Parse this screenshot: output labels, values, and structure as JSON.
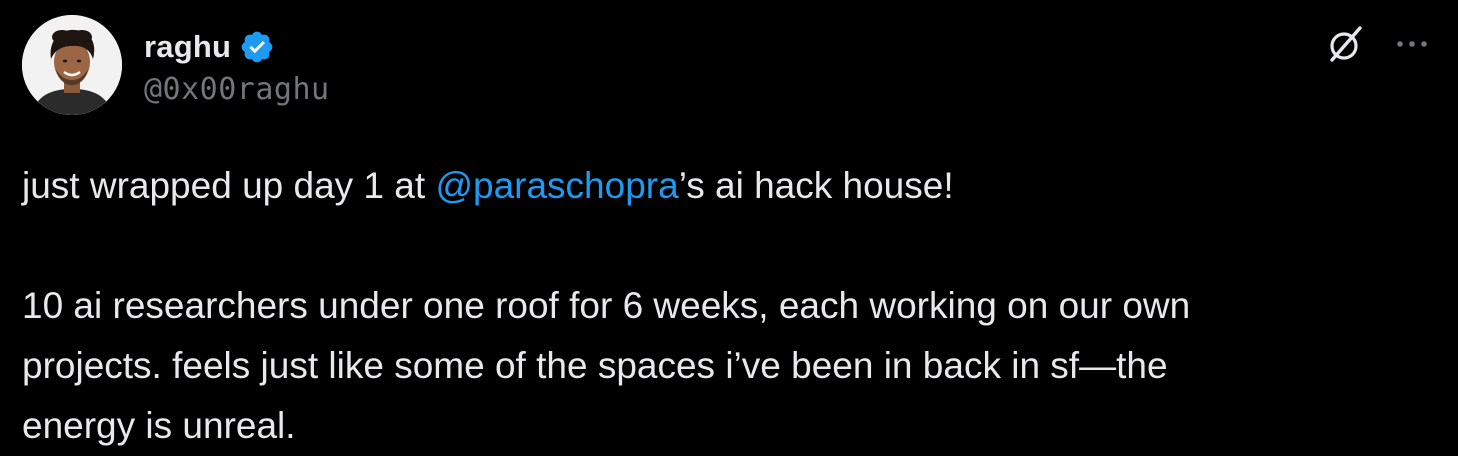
{
  "author": {
    "display_name": "raghu",
    "handle": "@0x00raghu",
    "verified": true,
    "avatar_icon": "profile-photo"
  },
  "actions": {
    "grok_icon": "grok-slash-icon",
    "more_icon": "more-dots-icon"
  },
  "tweet": {
    "paragraph1_before": "just wrapped up day 1 at ",
    "mention": "@paraschopra",
    "paragraph1_after": "’s ai hack house!",
    "paragraph2_line1": "10 ai researchers under one roof for 6 weeks, each working on our own",
    "paragraph2_line2": "projects. feels just like some of the spaces i’ve been in back in sf—the",
    "paragraph2_line3": "energy is unreal."
  },
  "colors": {
    "background": "#000000",
    "text": "#e7e9ea",
    "secondary": "#71767b",
    "accent": "#1d9bf0"
  }
}
